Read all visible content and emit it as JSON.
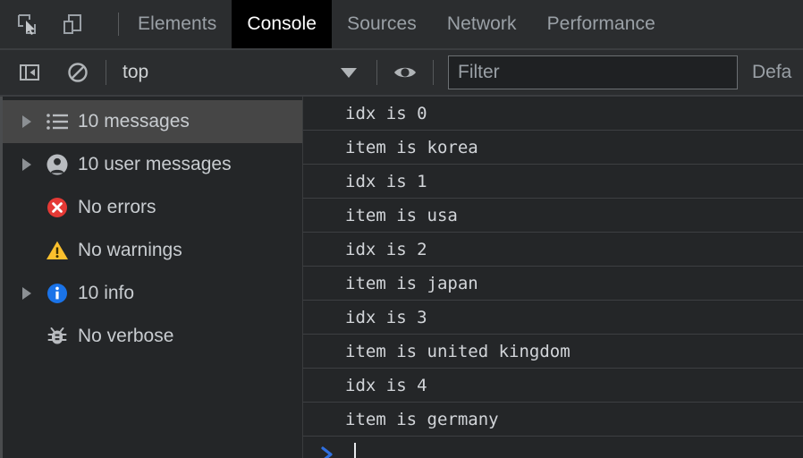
{
  "toolbar": {
    "inspect_icon": "inspect-element-icon",
    "device_icon": "device-toolbar-icon",
    "tabs": [
      {
        "label": "Elements",
        "selected": false
      },
      {
        "label": "Console",
        "selected": true
      },
      {
        "label": "Sources",
        "selected": false
      },
      {
        "label": "Network",
        "selected": false
      },
      {
        "label": "Performance",
        "selected": false
      }
    ]
  },
  "console_toolbar": {
    "sidebar_toggle_icon": "console-sidebar-toggle-icon",
    "clear_icon": "clear-console-icon",
    "context_value": "top",
    "caret_icon": "chevron-down-icon",
    "eye_icon": "live-expression-eye-icon",
    "filter_placeholder": "Filter",
    "levels_label": "Defa"
  },
  "sidebar": {
    "items": [
      {
        "label": "10 messages",
        "icon": "list-icon",
        "expandable": true,
        "selected": true,
        "color": "#b9bcc0"
      },
      {
        "label": "10 user messages",
        "icon": "user-icon",
        "expandable": true,
        "selected": false,
        "color": "#b9bcc0"
      },
      {
        "label": "No errors",
        "icon": "error-icon",
        "expandable": false,
        "selected": false,
        "color": "#e53935"
      },
      {
        "label": "No warnings",
        "icon": "warning-icon",
        "expandable": false,
        "selected": false,
        "color": "#fbc02d"
      },
      {
        "label": "10 info",
        "icon": "info-icon",
        "expandable": true,
        "selected": false,
        "color": "#1a73e8"
      },
      {
        "label": "No verbose",
        "icon": "bug-icon",
        "expandable": false,
        "selected": false,
        "color": "#b9bcc0"
      }
    ]
  },
  "console": {
    "messages": [
      "idx is 0",
      "item is korea",
      "idx is 1",
      "item is usa",
      "idx is 2",
      "item is japan",
      "idx is 3",
      "item is united kingdom",
      "idx is 4",
      "item is germany"
    ],
    "prompt_symbol": "prompt-chevron-icon",
    "prompt_value": "",
    "prompt_color": "#2f6fe0"
  }
}
